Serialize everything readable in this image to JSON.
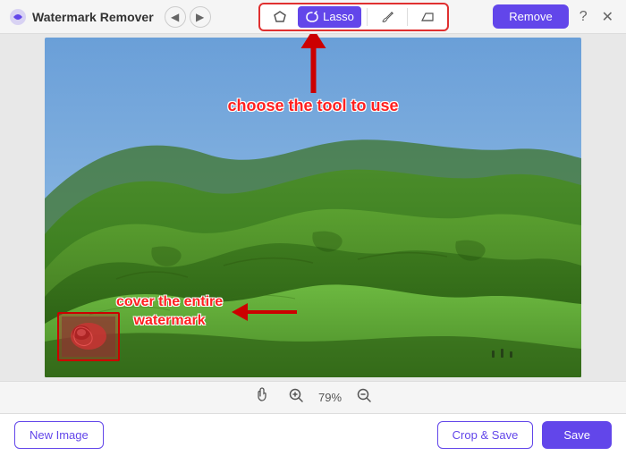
{
  "app": {
    "title": "Watermark Remover",
    "logo_icon": "app-logo-icon"
  },
  "header": {
    "nav_back_label": "◀",
    "nav_forward_label": "▶",
    "remove_button_label": "Remove",
    "help_icon": "?",
    "close_icon": "✕"
  },
  "toolbar": {
    "tools": [
      {
        "id": "polygon",
        "label": "✦",
        "active": false
      },
      {
        "id": "lasso",
        "label": "Lasso",
        "active": true
      },
      {
        "id": "brush",
        "label": "✏",
        "active": false
      },
      {
        "id": "eraser",
        "label": "⟡",
        "active": false
      }
    ]
  },
  "annotations": {
    "top_text": "choose the tool to use",
    "bottom_text": "cover the entire\nwatermark"
  },
  "status_bar": {
    "hand_icon": "✋",
    "zoom_in_icon": "⊕",
    "zoom_level": "79%",
    "zoom_out_icon": "⊖"
  },
  "footer": {
    "new_image_label": "New Image",
    "crop_save_label": "Crop & Save",
    "save_label": "Save"
  }
}
